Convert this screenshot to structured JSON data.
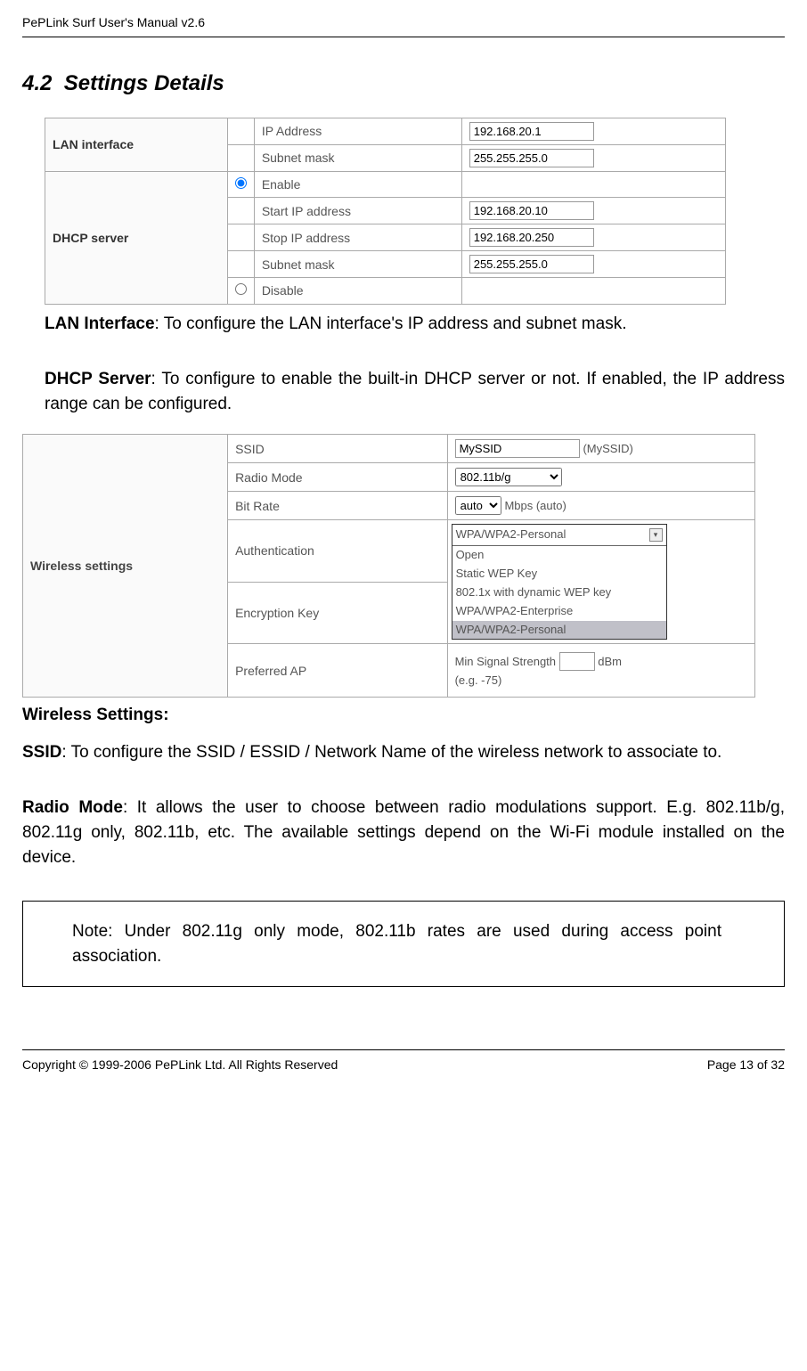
{
  "header": {
    "doc_title": "PePLink Surf User's Manual v2.6"
  },
  "section": {
    "number": "4.2",
    "title": "Settings Details"
  },
  "lan_table": {
    "row_lan_label": "LAN interface",
    "ip_address_label": "IP Address",
    "ip_address_value": "192.168.20.1",
    "subnet_label": "Subnet mask",
    "subnet_value": "255.255.255.0",
    "row_dhcp_label": "DHCP server",
    "enable_label": "Enable",
    "start_ip_label": "Start IP address",
    "start_ip_value": "192.168.20.10",
    "stop_ip_label": "Stop IP address",
    "stop_ip_value": "192.168.20.250",
    "dhcp_subnet_label": "Subnet mask",
    "dhcp_subnet_value": "255.255.255.0",
    "disable_label": "Disable"
  },
  "paragraphs": {
    "lan_interface": ": To configure the LAN interface's IP address and subnet mask.",
    "lan_interface_bold": "LAN Interface",
    "dhcp_server_bold": "DHCP Server",
    "dhcp_server": ": To configure to enable the built-in DHCP server or not.  If enabled, the IP address range can be configured.",
    "wireless_settings_heading": "Wireless Settings:",
    "ssid_bold": "SSID",
    "ssid": ": To configure the SSID / ESSID / Network Name of the wireless network to associate to.",
    "radio_mode_bold": "Radio Mode",
    "radio_mode": ": It allows the user to choose between radio modulations support. E.g. 802.11b/g, 802.11g only, 802.11b, etc.   The available settings depend on the Wi-Fi module installed on the device.",
    "note": "Note: Under 802.11g only mode, 802.11b rates are used during access point association."
  },
  "wireless_table": {
    "section_label": "Wireless settings",
    "ssid_label": "SSID",
    "ssid_value": "MySSID",
    "ssid_paren": "(MySSID)",
    "radio_mode_label": "Radio Mode",
    "radio_mode_value": "802.11b/g",
    "bitrate_label": "Bit Rate",
    "bitrate_value": "auto",
    "bitrate_unit": "Mbps (auto)",
    "auth_label": "Authentication",
    "auth_selected": "WPA/WPA2-Personal",
    "auth_opts": {
      "o1": "Open",
      "o2": "Static WEP Key",
      "o3": "802.1x with dynamic WEP key",
      "o4": "WPA/WPA2-Enterprise",
      "o5": "WPA/WPA2-Personal"
    },
    "enc_label": "Encryption Key",
    "pref_ap_label": "Preferred AP",
    "min_sig_label": "Min Signal Strength",
    "min_sig_unit": "dBm",
    "min_sig_eg": "(e.g. -75)"
  },
  "footer": {
    "copyright": "Copyright © 1999-2006 PePLink Ltd. All Rights Reserved",
    "page": "Page 13 of 32"
  }
}
